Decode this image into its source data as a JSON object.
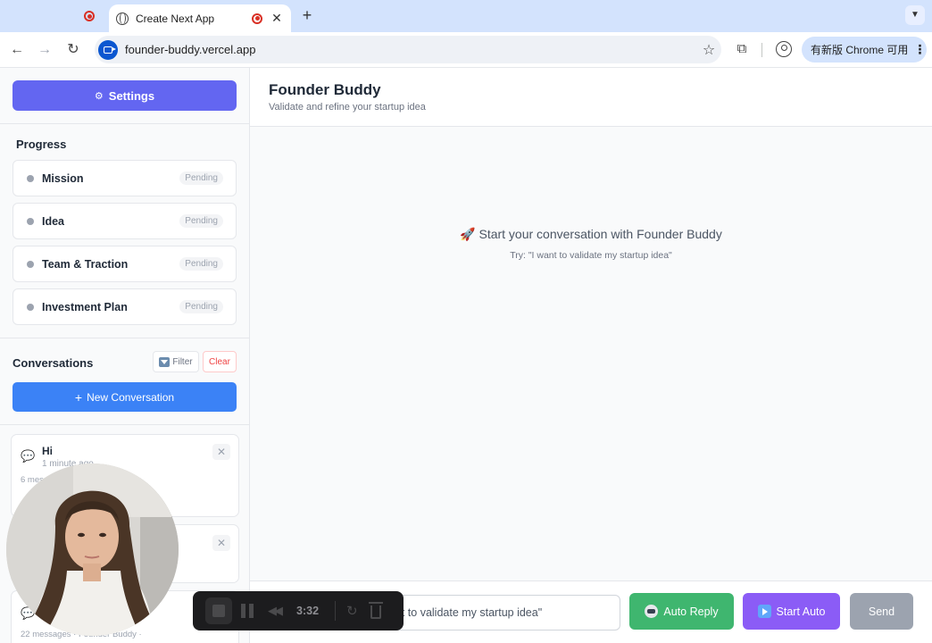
{
  "browser": {
    "tab_title": "Create Next App",
    "tab_close": "✕",
    "new_tab": "+",
    "url": "founder-buddy.vercel.app",
    "update_label": "有新版 Chrome 可用",
    "kebab": "⋮"
  },
  "sidebar": {
    "settings_label": "Settings",
    "progress_title": "Progress",
    "progress_items": [
      {
        "label": "Mission",
        "status": "Pending"
      },
      {
        "label": "Idea",
        "status": "Pending"
      },
      {
        "label": "Team & Traction",
        "status": "Pending"
      },
      {
        "label": "Investment Plan",
        "status": "Pending"
      }
    ],
    "conversations_title": "Conversations",
    "filter_label": "Filter",
    "clear_label": "Clear",
    "new_conversation_label": "New Conversation",
    "new_conversation_icon": "+",
    "conversations": [
      {
        "name": "Hi",
        "time": "1 minute ago",
        "meta": "6 messages · Founder Buddy ·"
      },
      {
        "name": "",
        "time": "",
        "meta": ""
      },
      {
        "name": "",
        "time": "",
        "meta": "22 messages · Founder Buddy ·"
      }
    ]
  },
  "main": {
    "title": "Founder Buddy",
    "subtitle": "Validate and refine your startup idea",
    "empty_title": "🚀 Start your conversation with Founder Buddy",
    "empty_hint": "Try: \"I want to validate my startup idea\"",
    "input_placeholder": "Try: \"I want to validate my startup idea\"",
    "auto_reply_label": "Auto Reply",
    "start_auto_label": "Start Auto",
    "send_label": "Send"
  },
  "recorder": {
    "elapsed": "3:32"
  },
  "colors": {
    "settings_button": "#6366f1",
    "new_conversation_button": "#3b82f6",
    "auto_reply_button": "#3fb66f",
    "start_auto_button": "#8b5cf6",
    "send_button": "#9ca3af",
    "pending_dot": "#9ca3af",
    "chrome_tabbar": "#d3e3fd"
  }
}
